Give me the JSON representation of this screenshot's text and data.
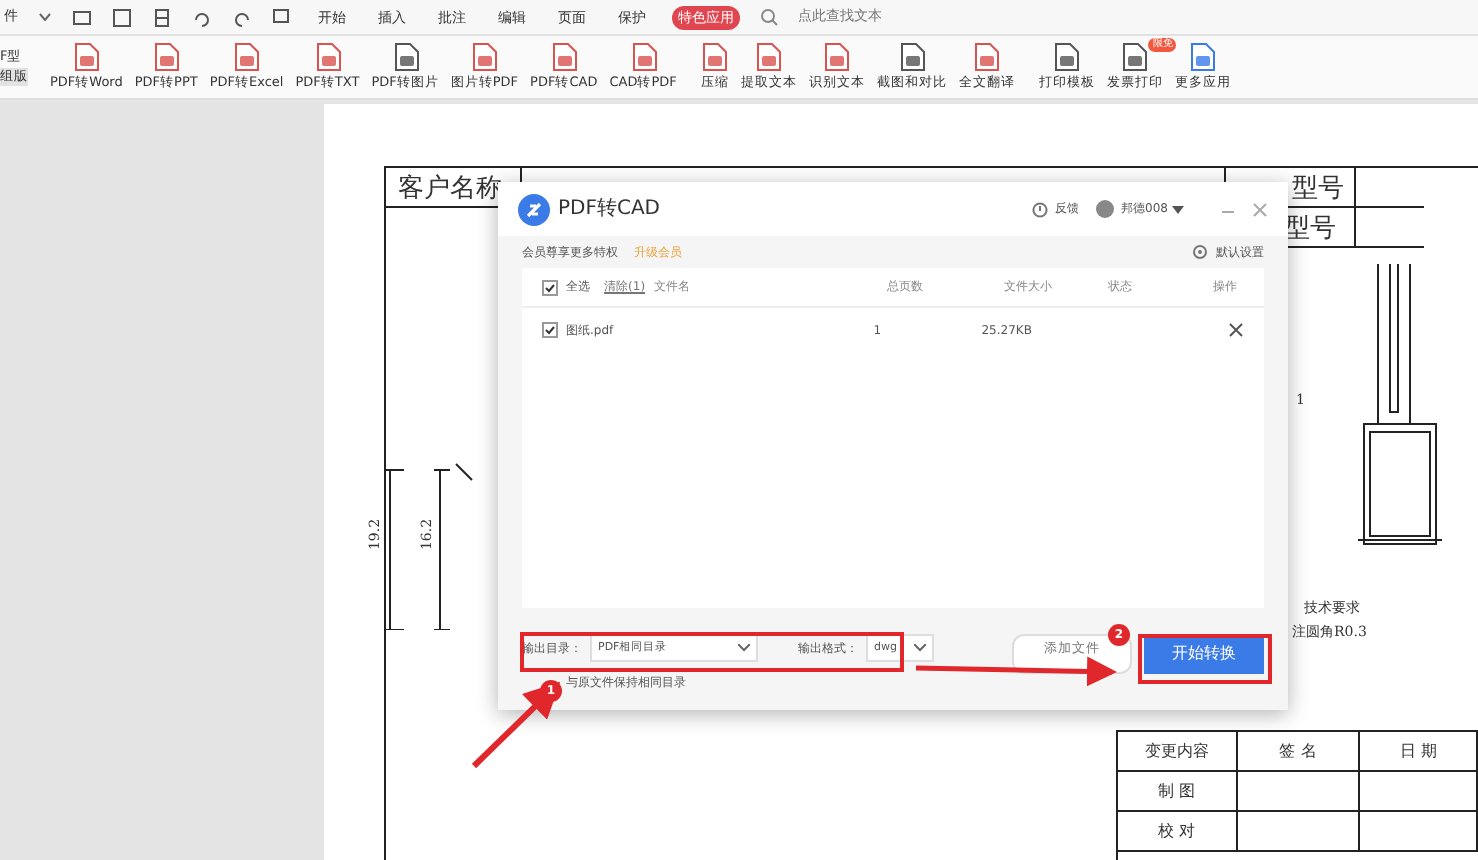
{
  "menu_bar": {
    "file_menu": "件",
    "tabs": [
      {
        "label": "开始",
        "selected": false
      },
      {
        "label": "插入",
        "selected": false
      },
      {
        "label": "批注",
        "selected": false
      },
      {
        "label": "编辑",
        "selected": false
      },
      {
        "label": "页面",
        "selected": false
      },
      {
        "label": "保护",
        "selected": false
      },
      {
        "label": "特色应用",
        "selected": true
      }
    ],
    "search": {
      "placeholder": "点此查找文本"
    }
  },
  "toolbar": {
    "side_labels": [
      "F型",
      "组版"
    ],
    "items": [
      {
        "label": "PDF转Word",
        "color": "#d9534f"
      },
      {
        "label": "PDF转PPT",
        "color": "#d9534f"
      },
      {
        "label": "PDF转Excel",
        "color": "#d9534f"
      },
      {
        "label": "PDF转TXT",
        "color": "#d9534f"
      },
      {
        "label": "PDF转图片",
        "color": "#555555"
      },
      {
        "label": "图片转PDF",
        "color": "#d9534f"
      },
      {
        "label": "PDF转CAD",
        "color": "#d9534f"
      },
      {
        "label": "CAD转PDF",
        "color": "#d9534f"
      },
      {
        "label": "压缩",
        "color": "#d9534f"
      },
      {
        "label": "提取文本",
        "color": "#d9534f"
      },
      {
        "label": "识别文本",
        "color": "#d9534f"
      },
      {
        "label": "截图和对比",
        "color": "#555555"
      },
      {
        "label": "全文翻译",
        "color": "#d9534f"
      },
      {
        "label": "打印模板",
        "color": "#555555"
      },
      {
        "label": "发票打印",
        "color": "#555555",
        "badge": "限免"
      },
      {
        "label": "更多应用",
        "color": "#3b7be8"
      }
    ]
  },
  "document": {
    "customer_name": "客户名称",
    "customer_model": "型号",
    "model": "型号",
    "dimension_outer": "19.2",
    "dimension_inner": "16.2",
    "side_mark": "1",
    "tech_title": "技术要求",
    "tech_note": "注圆角R0.3",
    "sign_table": [
      [
        "变更内容",
        "签 名",
        "日 期"
      ],
      [
        "制 图"
      ],
      [
        "校 对"
      ]
    ]
  },
  "dialog": {
    "title": "PDF转CAD",
    "feedback": "反馈",
    "user": "邦德008",
    "promo": "会员尊享更多特权",
    "upgrade": "升级会员",
    "settings": "默认设置",
    "columns": {
      "select_all": "全选",
      "select_all_checked": true,
      "clear": "清除(1)",
      "name": "文件名",
      "pages": "总页数",
      "size": "文件大小",
      "status": "状态",
      "action": "操作"
    },
    "files": [
      {
        "name": "图纸.pdf",
        "checked": true,
        "pages": "1",
        "size": "25.27KB"
      }
    ],
    "output_dir_label": "输出目录：",
    "output_dir": "PDF相同目录",
    "output_format_label": "输出格式：",
    "output_format": "dwg",
    "keep_dir_note": "与原文件保持相同目录",
    "add_button": "添加文件",
    "start_button": "开始转换"
  },
  "annotations": [
    {
      "label": "1"
    },
    {
      "label": "2"
    }
  ]
}
